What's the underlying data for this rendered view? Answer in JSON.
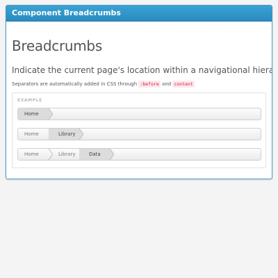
{
  "panel": {
    "title": "Component Breadcrumbs"
  },
  "page": {
    "heading": "Breadcrumbs",
    "lead": "Indicate the current page's location within a navigational hierarchy.",
    "note": {
      "prefix": "Separators are automatically added in CSS through ",
      "code1": ":before",
      "middle": " and ",
      "code2": "content"
    }
  },
  "example": {
    "label": "EXAMPLE",
    "breadcrumbs": [
      {
        "items": [
          {
            "label": "Home",
            "active": true
          }
        ]
      },
      {
        "items": [
          {
            "label": "Home",
            "active": false
          },
          {
            "label": "Library",
            "active": true
          }
        ]
      },
      {
        "items": [
          {
            "label": "Home",
            "active": false
          },
          {
            "label": "Library",
            "active": false
          },
          {
            "label": "Data",
            "active": true
          }
        ]
      }
    ]
  },
  "colors": {
    "header": "#2a8bc0",
    "active_crumb": "#dcdcdc",
    "code_bg": "#fbe9e9",
    "code_text": "#dd1144"
  }
}
